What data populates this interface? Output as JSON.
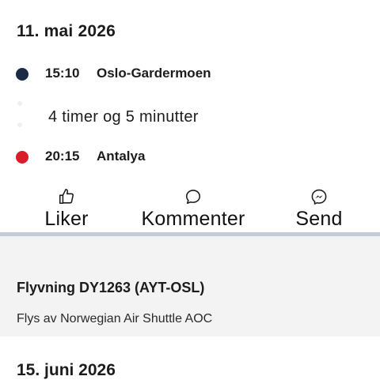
{
  "trip": {
    "date": "11. mai 2026",
    "departure": {
      "time": "15:10",
      "place": "Oslo-Gardermoen",
      "color": "#1b2a47"
    },
    "duration": "4 timer og 5 minutter",
    "arrival": {
      "time": "20:15",
      "place": "Antalya",
      "color": "#d81e2a"
    }
  },
  "actions": {
    "like": {
      "label": "Liker",
      "icon": "thumbs-up-icon"
    },
    "comment": {
      "label": "Kommenter",
      "icon": "speech-bubble-icon"
    },
    "send": {
      "label": "Send",
      "icon": "messenger-icon"
    }
  },
  "flight": {
    "title": "Flyvning DY1263 (AYT-OSL)",
    "operator": "Flys av Norwegian Air Shuttle AOC"
  },
  "next": {
    "date": "15. juni 2026"
  }
}
